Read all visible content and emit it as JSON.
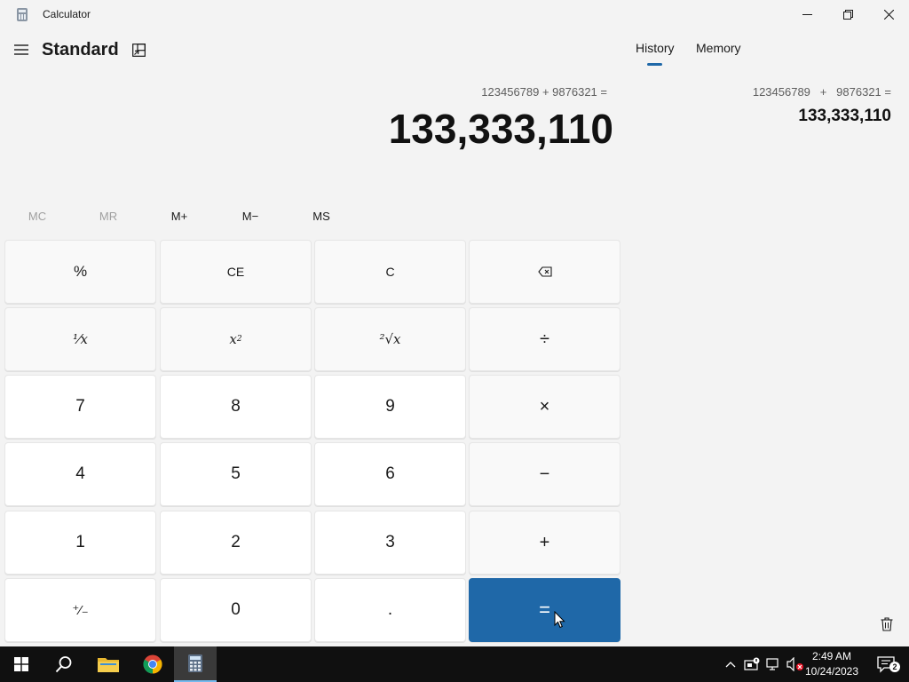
{
  "window": {
    "title": "Calculator",
    "icons": {
      "app": "calculator-icon",
      "minimize": "minimize-icon",
      "maximize": "restore-icon",
      "close": "close-icon"
    }
  },
  "header": {
    "mode": "Standard",
    "menu_icon": "hamburger-icon",
    "keep_on_top_icon": "keep-on-top-icon"
  },
  "display": {
    "expression": "123456789 + 9876321 =",
    "result": "133,333,110"
  },
  "memory": {
    "mc": "MC",
    "mr": "MR",
    "mplus": "M+",
    "mminus": "M−",
    "ms": "MS",
    "mc_enabled": false,
    "mr_enabled": false
  },
  "keys": {
    "percent": "%",
    "ce": "CE",
    "c": "C",
    "backspace": "⌫",
    "reciprocal": "¹⁄x",
    "square_base": "x",
    "square_exp": "2",
    "sqrt": "²√x",
    "divide": "÷",
    "seven": "7",
    "eight": "8",
    "nine": "9",
    "multiply": "×",
    "four": "4",
    "five": "5",
    "six": "6",
    "minus": "−",
    "one": "1",
    "two": "2",
    "three": "3",
    "plus": "+",
    "negate": "⁺⁄₋",
    "zero": "0",
    "decimal": ".",
    "equals": "="
  },
  "history_panel": {
    "tabs": [
      "History",
      "Memory"
    ],
    "active_tab": "History",
    "entries": [
      {
        "expression": "123456789   +   9876321 =",
        "result": "133,333,110"
      }
    ],
    "clear_icon": "trash-icon"
  },
  "taskbar": {
    "items": [
      "start-icon",
      "search-icon",
      "file-explorer-icon",
      "chrome-icon",
      "calculator-icon"
    ],
    "tray_icons": [
      "chevron-up-icon",
      "network-icon",
      "display-icon",
      "volume-muted-icon"
    ],
    "time": "2:49 AM",
    "date": "10/24/2023",
    "notification_count": "2"
  },
  "colors": {
    "accent": "#1f68a8",
    "background": "#f3f3f3",
    "key_number": "#ffffff",
    "key_function": "#f9f9f9",
    "taskbar": "#101010"
  }
}
